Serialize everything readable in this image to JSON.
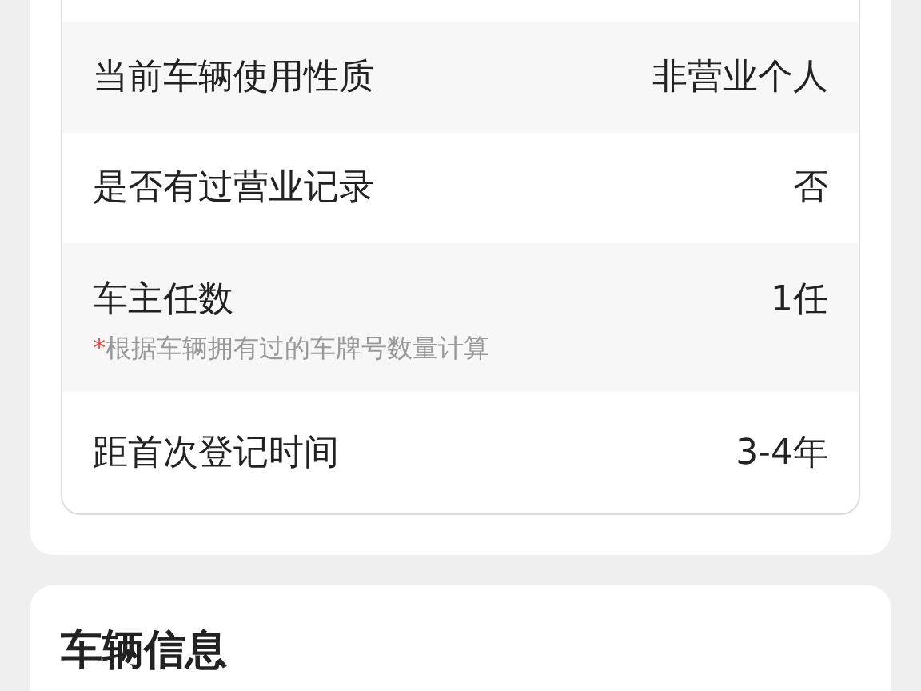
{
  "history_rows": [
    {
      "label": "当前车辆使用性质",
      "value": "非营业个人"
    },
    {
      "label": "是否有过营业记录",
      "value": "否"
    },
    {
      "label": "车主任数",
      "value": "1任",
      "note_mark": "*",
      "note": "根据车辆拥有过的车牌号数量计算"
    },
    {
      "label": "距首次登记时间",
      "value": "3-4年"
    }
  ],
  "next_section": {
    "title": "车辆信息"
  }
}
